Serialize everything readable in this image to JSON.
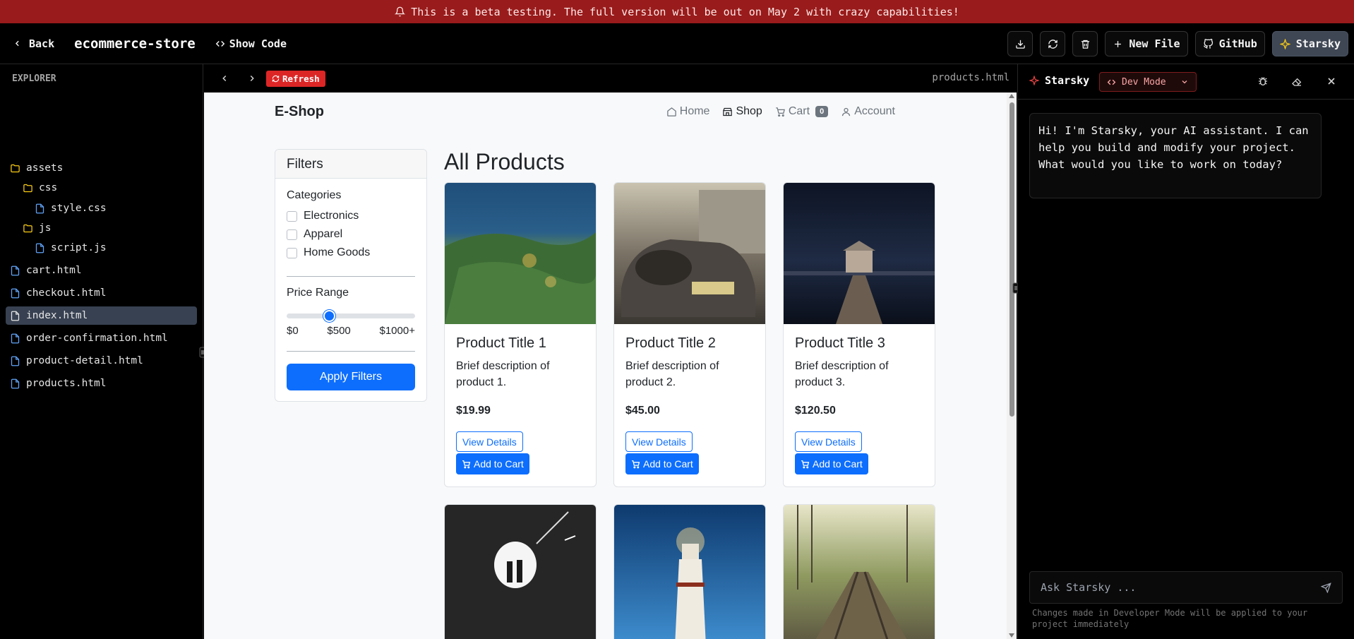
{
  "banner": {
    "text": "This is a beta testing. The full version will be out on May 2 with crazy capabilities!"
  },
  "topbar": {
    "back_label": "Back",
    "project_name": "ecommerce-store",
    "show_code_label": "Show Code",
    "new_file_label": "New File",
    "github_label": "GitHub",
    "starsky_label": "Starsky"
  },
  "explorer": {
    "title": "EXPLORER",
    "items": [
      {
        "label": "assets",
        "type": "folder"
      },
      {
        "label": "css",
        "type": "folder"
      },
      {
        "label": "style.css",
        "type": "file"
      },
      {
        "label": "js",
        "type": "folder"
      },
      {
        "label": "script.js",
        "type": "file"
      },
      {
        "label": "cart.html",
        "type": "file"
      },
      {
        "label": "checkout.html",
        "type": "file"
      },
      {
        "label": "index.html",
        "type": "file",
        "active": true
      },
      {
        "label": "order-confirmation.html",
        "type": "file"
      },
      {
        "label": "product-detail.html",
        "type": "file"
      },
      {
        "label": "products.html",
        "type": "file"
      }
    ]
  },
  "preview": {
    "refresh_label": "Refresh",
    "filename": "products.html"
  },
  "site": {
    "brand": "E-Shop",
    "nav": {
      "home": "Home",
      "shop": "Shop",
      "cart": "Cart",
      "cart_count": "0",
      "account": "Account"
    },
    "filters": {
      "header": "Filters",
      "categories_label": "Categories",
      "categories": [
        "Electronics",
        "Apparel",
        "Home Goods"
      ],
      "price_label": "Price Range",
      "price_min": "$0",
      "price_mid": "$500",
      "price_max": "$1000+",
      "price_value_fraction": 0.33,
      "apply_label": "Apply Filters"
    },
    "page_title": "All Products",
    "products": [
      {
        "title": "Product Title 1",
        "desc": "Brief description of product 1.",
        "price": "$19.99",
        "details_label": "View Details",
        "cart_label": "Add to Cart"
      },
      {
        "title": "Product Title 2",
        "desc": "Brief description of product 2.",
        "price": "$45.00",
        "details_label": "View Details",
        "cart_label": "Add to Cart"
      },
      {
        "title": "Product Title 3",
        "desc": "Brief description of product 3.",
        "price": "$120.50",
        "details_label": "View Details",
        "cart_label": "Add to Cart"
      }
    ]
  },
  "chat": {
    "title": "Starsky",
    "mode_label": "Dev Mode",
    "message": "Hi! I'm Starsky, your AI assistant. I can help you build and modify your project. What would you like to work on today?",
    "input_placeholder": "Ask Starsky ...",
    "note": "Changes made in Developer Mode will be applied to your project immediately"
  },
  "colors": {
    "banner": "#991b1b",
    "accent_blue": "#0d6efd",
    "refresh_red": "#dc2626",
    "starsky_yellow": "#facc15"
  }
}
